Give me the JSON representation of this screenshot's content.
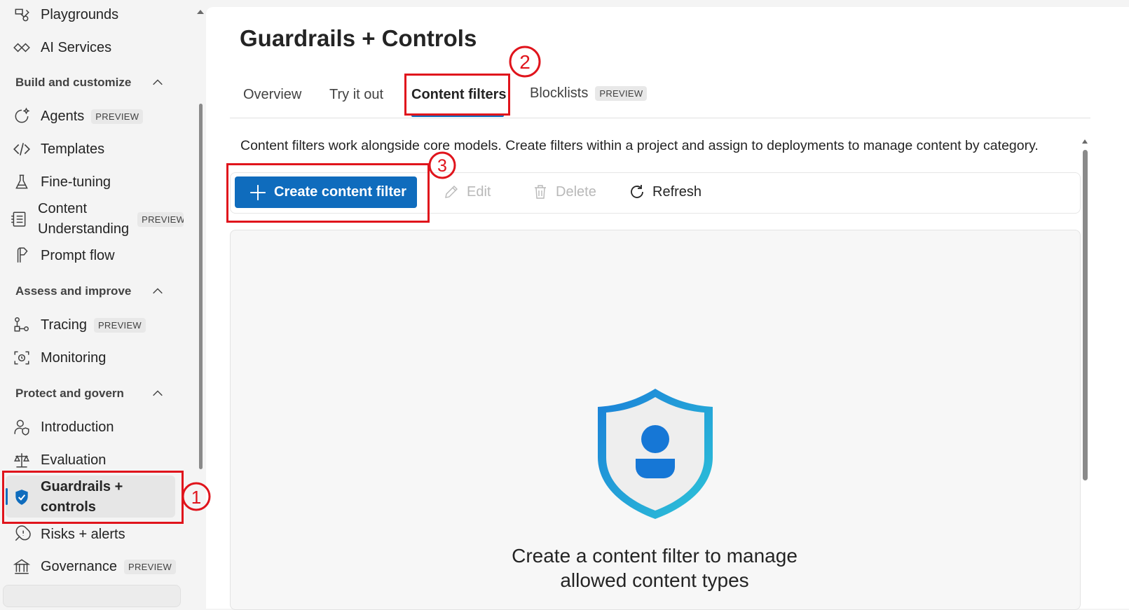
{
  "sidebar": {
    "items_top": [
      {
        "label": "Playgrounds",
        "icon": "playground-icon"
      },
      {
        "label": "AI Services",
        "icon": "ai-services-icon"
      }
    ],
    "sections": [
      {
        "title": "Build and customize"
      },
      {
        "title": "Assess and improve"
      },
      {
        "title": "Protect and govern"
      }
    ],
    "build": [
      {
        "label": "Agents",
        "badge": "PREVIEW"
      },
      {
        "label": "Templates"
      },
      {
        "label": "Fine-tuning"
      },
      {
        "label_line1": "Content",
        "label_line2": "Understanding",
        "badge": "PREVIEW"
      },
      {
        "label": "Prompt flow"
      }
    ],
    "assess": [
      {
        "label": "Tracing",
        "badge": "PREVIEW"
      },
      {
        "label": "Monitoring"
      }
    ],
    "protect": [
      {
        "label": "Introduction"
      },
      {
        "label": "Evaluation"
      },
      {
        "label_line1": "Guardrails +",
        "label_line2": "controls",
        "selected": true
      },
      {
        "label": "Risks + alerts"
      },
      {
        "label": "Governance",
        "badge": "PREVIEW"
      }
    ]
  },
  "main": {
    "title": "Guardrails + Controls",
    "tabs": [
      {
        "label": "Overview"
      },
      {
        "label": "Try it out"
      },
      {
        "label": "Content filters",
        "active": true
      },
      {
        "label": "Blocklists",
        "badge": "PREVIEW"
      }
    ],
    "description": "Content filters work alongside core models. Create filters within a project and assign to deployments to manage content by category.",
    "toolbar": {
      "create_label": "Create content filter",
      "edit_label": "Edit",
      "delete_label": "Delete",
      "refresh_label": "Refresh"
    },
    "empty_state": {
      "title_line1": "Create a content filter to manage",
      "title_line2": "allowed content types"
    }
  },
  "annotations": [
    "1",
    "2",
    "3"
  ],
  "colors": {
    "accent": "#0f6cbd",
    "annotation_red": "#e0141c"
  }
}
